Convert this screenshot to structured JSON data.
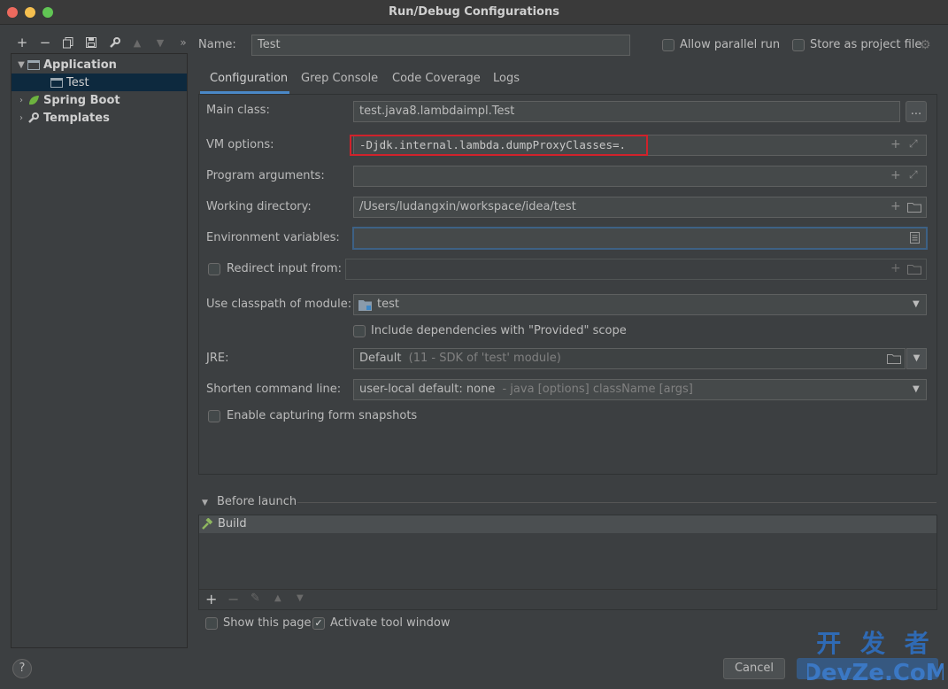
{
  "window": {
    "title": "Run/Debug Configurations"
  },
  "sidebar": {
    "tree": [
      {
        "label": "Application",
        "expanded": true
      },
      {
        "label": "Test",
        "selected": true
      },
      {
        "label": "Spring Boot",
        "expanded": false
      },
      {
        "label": "Templates",
        "expanded": false
      }
    ]
  },
  "header": {
    "name_label": "Name:",
    "name_value": "Test",
    "allow_parallel_label": "Allow parallel run",
    "store_project_label": "Store as project file"
  },
  "tabs": [
    "Configuration",
    "Grep Console",
    "Code Coverage",
    "Logs"
  ],
  "form": {
    "main_class_label": "Main class:",
    "main_class_value": "test.java8.lambdaimpl.Test",
    "browse_label": "...",
    "vm_options_label": "VM options:",
    "vm_options_value": "-Djdk.internal.lambda.dumpProxyClasses=.",
    "program_args_label": "Program arguments:",
    "working_dir_label": "Working directory:",
    "working_dir_value": "/Users/ludangxin/workspace/idea/test",
    "env_vars_label": "Environment variables:",
    "redirect_label": "Redirect input from:",
    "classpath_label": "Use classpath of module:",
    "classpath_value": "test",
    "include_deps_label": "Include dependencies with \"Provided\" scope",
    "jre_label": "JRE:",
    "jre_value": "Default",
    "jre_hint": "(11 - SDK of 'test' module)",
    "shorten_label": "Shorten command line:",
    "shorten_value": "user-local default: none",
    "shorten_hint": "- java [options] className [args]",
    "snapshots_label": "Enable capturing form snapshots"
  },
  "before_launch": {
    "title": "Before launch",
    "items": [
      "Build"
    ]
  },
  "footer": {
    "show_page_label": "Show this page",
    "activate_tool_label": "Activate tool window",
    "cancel_label": "Cancel",
    "help_label": "?"
  },
  "watermark": "开 发 者 DevZe.CoM",
  "colors": {
    "accent": "#4a88c7",
    "highlight_box": "#d0222b",
    "background": "#3c3f41"
  }
}
